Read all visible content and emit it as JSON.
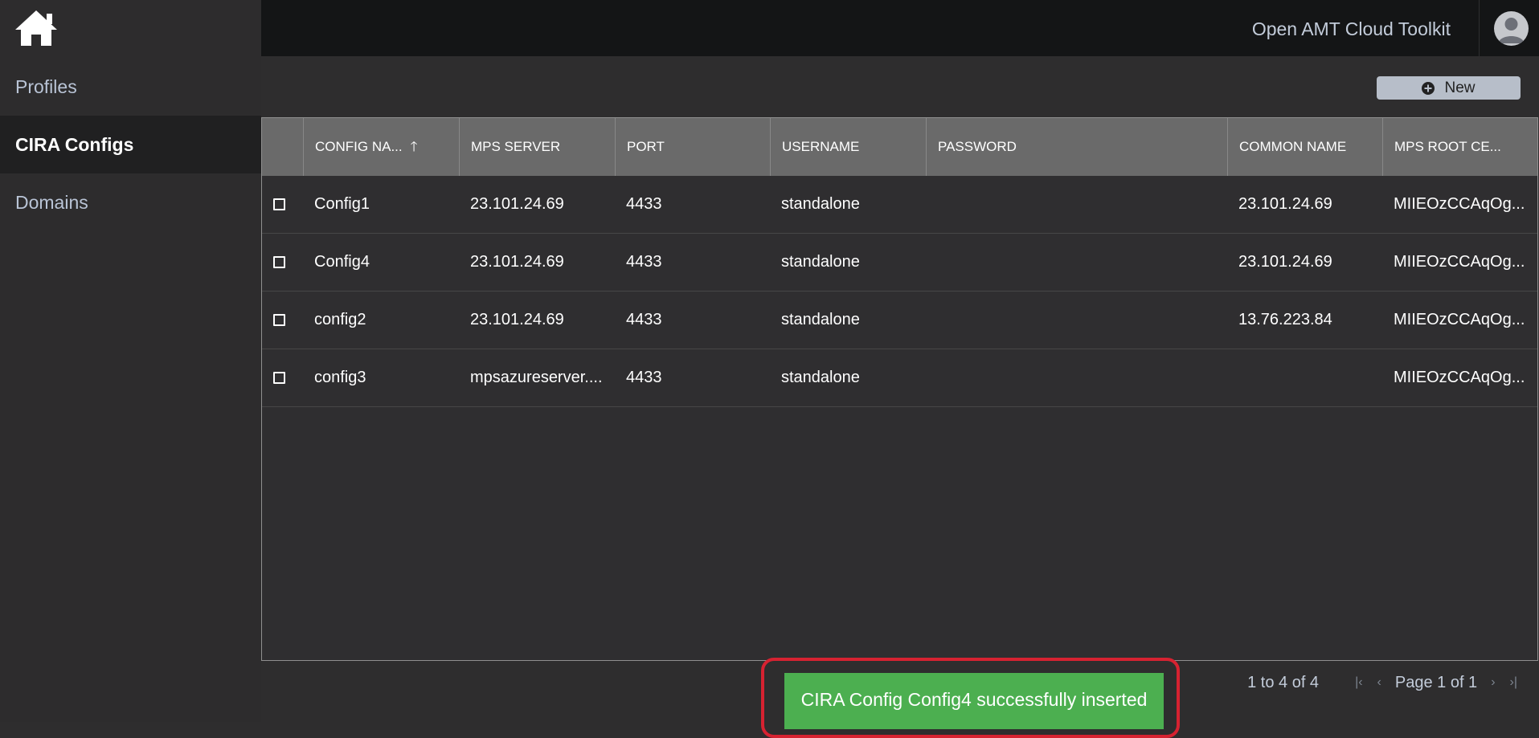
{
  "sidebar": {
    "items": [
      {
        "label": "Profiles",
        "active": false
      },
      {
        "label": "CIRA Configs",
        "active": true
      },
      {
        "label": "Domains",
        "active": false
      }
    ]
  },
  "topbar": {
    "title": "Open AMT Cloud Toolkit"
  },
  "toolbar": {
    "new_label": "New"
  },
  "table": {
    "columns": [
      "CONFIG NA...",
      "MPS SERVER",
      "PORT",
      "USERNAME",
      "PASSWORD",
      "COMMON NAME",
      "MPS ROOT CE..."
    ],
    "rows": [
      [
        "Config1",
        "23.101.24.69",
        "4433",
        "standalone",
        "",
        "23.101.24.69",
        "MIIEOzCCAqOg..."
      ],
      [
        "Config4",
        "23.101.24.69",
        "4433",
        "standalone",
        "",
        "23.101.24.69",
        "MIIEOzCCAqOg..."
      ],
      [
        "config2",
        "23.101.24.69",
        "4433",
        "standalone",
        "",
        "13.76.223.84",
        "MIIEOzCCAqOg..."
      ],
      [
        "config3",
        "mpsazureserver....",
        "4433",
        "standalone",
        "",
        "",
        "MIIEOzCCAqOg..."
      ]
    ]
  },
  "pager": {
    "count": "1 to 4 of 4",
    "page": "Page 1 of 1"
  },
  "toast": {
    "message": "CIRA Config Config4 successfully inserted"
  },
  "colors": {
    "sidebar_bg": "#2d2c2d",
    "topbar_bg": "#141516",
    "header_bg": "#6a6a6a",
    "toast_bg": "#4caf50",
    "highlight": "#d62231"
  }
}
